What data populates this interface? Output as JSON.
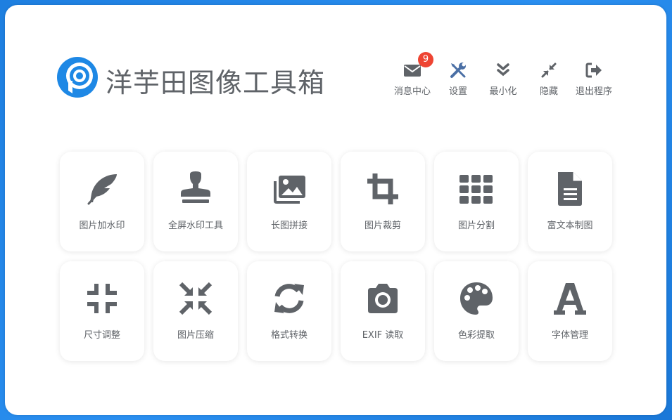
{
  "app": {
    "title": "洋芋田图像工具箱"
  },
  "header_actions": [
    {
      "label": "消息中心",
      "icon": "envelope-icon",
      "badge": "9"
    },
    {
      "label": "设置",
      "icon": "tools-icon"
    },
    {
      "label": "最小化",
      "icon": "chevron-double-down-icon"
    },
    {
      "label": "隐藏",
      "icon": "compress-arrows-icon"
    },
    {
      "label": "退出程序",
      "icon": "sign-out-icon"
    }
  ],
  "tools": [
    {
      "label": "图片加水印",
      "icon": "feather-icon"
    },
    {
      "label": "全屏水印工具",
      "icon": "stamp-icon"
    },
    {
      "label": "长图拼接",
      "icon": "images-icon"
    },
    {
      "label": "图片裁剪",
      "icon": "crop-icon"
    },
    {
      "label": "图片分割",
      "icon": "grid-icon"
    },
    {
      "label": "富文本制图",
      "icon": "document-icon"
    },
    {
      "label": "尺寸调整",
      "icon": "compress-icon"
    },
    {
      "label": "图片压缩",
      "icon": "compress-arrows-icon"
    },
    {
      "label": "格式转换",
      "icon": "sync-icon"
    },
    {
      "label": "EXIF 读取",
      "icon": "camera-icon"
    },
    {
      "label": "色彩提取",
      "icon": "palette-icon"
    },
    {
      "label": "字体管理",
      "icon": "font-icon"
    }
  ],
  "colors": {
    "accent": "#1e88e5",
    "icon": "#5f6368",
    "badge": "#ee4432",
    "background": "#1e7fe0"
  }
}
